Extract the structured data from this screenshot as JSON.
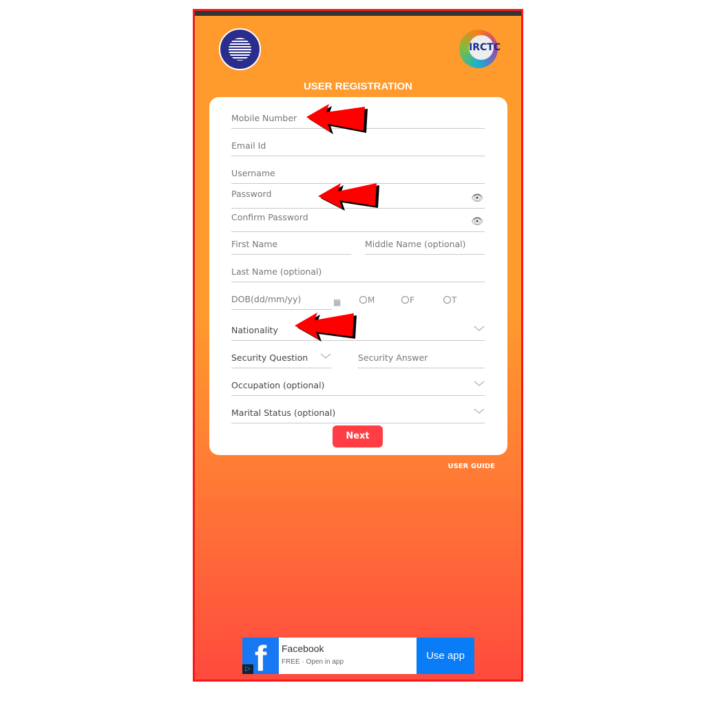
{
  "header": {
    "title": "USER REGISTRATION",
    "left_logo": "indian-railways-logo",
    "right_logo": "irctc-logo",
    "right_logo_text": "IRCTC"
  },
  "form": {
    "mobile": "Mobile Number",
    "email": "Email Id",
    "username": "Username",
    "password": "Password",
    "confirm_password": "Confirm Password",
    "first_name": "First Name",
    "middle_name": "Middle Name (optional)",
    "last_name": "Last Name (optional)",
    "dob": "DOB(dd/mm/yy)",
    "gender": [
      "M",
      "F",
      "T"
    ],
    "nationality": "Nationality",
    "security_question": "Security Question",
    "security_answer": "Security Answer",
    "occupation": "Occupation (optional)",
    "marital_status": "Marital Status (optional)",
    "next": "Next"
  },
  "user_guide": "USER GUIDE",
  "ad": {
    "name": "Facebook",
    "subtitle": "FREE · Open in app",
    "cta": "Use app",
    "icon": "f"
  },
  "colors": {
    "accent": "#ff3d44",
    "background_top": "#ff9a2d",
    "background_bottom": "#ff4a3e",
    "annotation_arrow": "#ff0000"
  }
}
